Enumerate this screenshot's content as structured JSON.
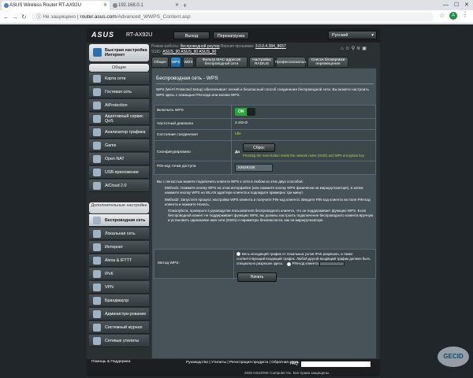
{
  "browser": {
    "tabs": [
      {
        "label": "ASUS Wireless Router RT-AX92U"
      },
      {
        "label": "192.168.0.1"
      }
    ],
    "url_security": "Не защищено",
    "url_host": "router.asus.com",
    "url_path": "/Advanced_WWPS_Content.asp",
    "avatar_letter": "A"
  },
  "header": {
    "logo": "ASUS",
    "model": "RT-AX92U",
    "logout_label": "Выход",
    "reboot_label": "Перезагрузка",
    "language": "Русский"
  },
  "info": {
    "mode_label": "Режим работы:",
    "mode_value": "беспроводной роутер",
    "firmware_label": "Версия прошивки:",
    "firmware_value": "3.0.0.4.384_8657",
    "ssid_label": "SSID:",
    "ssid_values": "ASUS_90  ASUS_90  ASUS_90"
  },
  "sidebar": {
    "setup_label": "Быстрая настройка Интернет",
    "general_header": "Общие",
    "general_items": [
      "Карта сети",
      "Гостевая сеть",
      "AiProtection",
      "Адаптивный сервис QoS",
      "Анализатор трафика",
      "Game",
      "Open NAT",
      "USB-приложение",
      "AiCloud 2.0"
    ],
    "advanced_header": "Дополнительные настройки",
    "advanced_items": [
      "Беспроводная сеть",
      "Локальная сеть",
      "Интернет",
      "Alexa & IFTTT",
      "IPv6",
      "VPN",
      "Брандмауэр",
      "Администри-рование",
      "Системный журнал",
      "Сетевые утилиты"
    ]
  },
  "content_tabs": [
    "Общие",
    "WPS",
    "WDS",
    "Фильтр MAC-адресов беспроводной сети",
    "Настройка RADIUS",
    "Профессиональн.",
    "Список блокировки перемещения"
  ],
  "page": {
    "title": "Беспроводная сеть - WPS",
    "description": "WPS (Wi-Fi Protected Setup) обеспечивает легкий и безопасный способ соединения беспроводной сети. Вы можете настроить WPS здесь с помощью PIN-кода или кнопки WPS.",
    "rows": [
      {
        "label": "Включить WPS",
        "value": "ON"
      },
      {
        "label": "Частотный диапазон",
        "value": "2.4GHz"
      },
      {
        "label": "Состояние соединения",
        "value": "Idle"
      },
      {
        "label": "Сконфигурировано",
        "value": "Да",
        "button": "Сброс",
        "note": "Pressing the reset button resets the network name (SSID) and WPA encryption key."
      },
      {
        "label": "PIN-код точки доступа",
        "value": "63629338"
      }
    ],
    "instr_intro": "Вы с легкостью можете подключить клиента WPS к сети в любом из этих двух способов:",
    "instr_m1": "Method1: Нажмите кнопку WPS на этом интерфейсе (или нажмите кнопку WPS физически на маршрутизаторе), а затем нажмите кнопку WPS на WLAN адаптере клиента и подождите примерно три минут.",
    "instr_m2": "Method2: Запустите процесс настройки WPS клиента и получите PIN-код клиента. Введите PIN-код клиента на поле PIN-код клиента и нажмите Начать.",
    "instr_m2b": "Пожалуйста, проверьте в руководстве пользователя беспроводного клиента, что он поддерживает функцию WPS. Если беспроводной клиент не поддерживает функцию WPS, вы должны настроить подключение беспроводного клиента вручную и установить одинаковое имя сети (SSID) и параметры безопасности, как на маршрутизаторе.",
    "method_label": "Метод WPS:",
    "method_opt1": "Весь исходящий трафик от локальных узлов IPv6 разрешен, а также соответствующий входящий трафик. Любой другой входящий трафик должен быть специально разрешен здесь.",
    "method_opt2": "PIN-код клиента",
    "start_label": "Начать"
  },
  "footer": {
    "help": "Помощь & Поддержка",
    "links": "Руководство | Утилиты | Регистрация продукта | Обратная связь",
    "faq": "FAQ",
    "copyright": "2020 ASUSTeK Computer Inc. Все права защищены."
  }
}
